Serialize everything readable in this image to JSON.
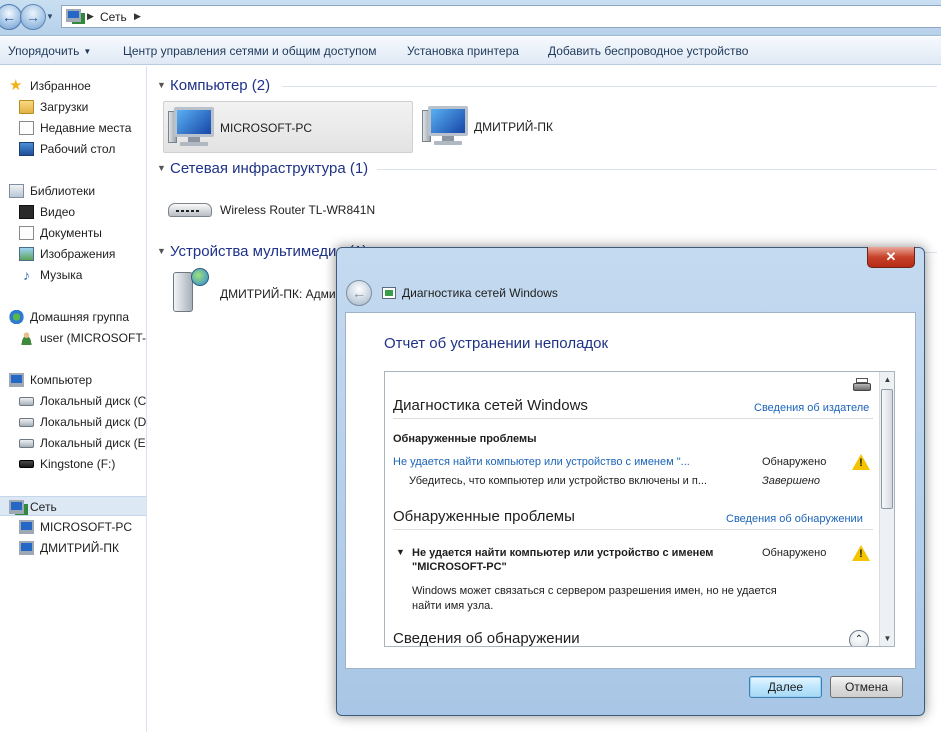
{
  "address_bar": {
    "crumb": "Сеть"
  },
  "toolbar": {
    "organize": "Упорядочить",
    "network_center": "Центр управления сетями и общим доступом",
    "add_printer": "Установка принтера",
    "add_wireless": "Добавить беспроводное устройство"
  },
  "nav": {
    "favorites": {
      "label": "Избранное",
      "icon": "star-icon",
      "items": [
        {
          "label": "Загрузки",
          "icon": "downloads-folder-icon"
        },
        {
          "label": "Недавние места",
          "icon": "recent-places-icon"
        },
        {
          "label": "Рабочий стол",
          "icon": "desktop-icon"
        }
      ]
    },
    "libraries": {
      "label": "Библиотеки",
      "icon": "libraries-icon",
      "items": [
        {
          "label": "Видео",
          "icon": "video-icon"
        },
        {
          "label": "Документы",
          "icon": "documents-icon"
        },
        {
          "label": "Изображения",
          "icon": "pictures-icon"
        },
        {
          "label": "Музыка",
          "icon": "music-icon"
        }
      ]
    },
    "homegroup": {
      "label": "Домашняя группа",
      "icon": "homegroup-icon",
      "items": [
        {
          "label": "user (MICROSOFT-PC)",
          "icon": "user-icon"
        }
      ]
    },
    "computer": {
      "label": "Компьютер",
      "icon": "computer-icon",
      "items": [
        {
          "label": "Локальный диск (C:)",
          "icon": "local-disk-icon"
        },
        {
          "label": "Локальный диск (D:)",
          "icon": "local-disk-icon"
        },
        {
          "label": "Локальный диск (E:)",
          "icon": "local-disk-icon"
        },
        {
          "label": "Kingstone (F:)",
          "icon": "usb-drive-icon"
        }
      ]
    },
    "network": {
      "label": "Сеть",
      "icon": "network-icon",
      "items": [
        {
          "label": "MICROSOFT-PC",
          "icon": "computer-icon"
        },
        {
          "label": "ДМИТРИЙ-ПК",
          "icon": "computer-icon"
        }
      ]
    }
  },
  "content": {
    "groups": [
      {
        "title": "Компьютер (2)",
        "items": [
          {
            "label": "MICROSOFT-PC",
            "icon": "computer-icon",
            "selected": true
          },
          {
            "label": "ДМИТРИЙ-ПК",
            "icon": "computer-icon"
          }
        ]
      },
      {
        "title": "Сетевая инфраструктура (1)",
        "items": [
          {
            "label": "Wireless Router TL-WR841N",
            "icon": "router-icon"
          }
        ]
      },
      {
        "title": "Устройства мультимедиа (1)",
        "items": [
          {
            "label": "ДМИТРИЙ-ПК: Администратор",
            "icon": "media-device-icon"
          }
        ]
      }
    ]
  },
  "dialog": {
    "title": "Диагностика сетей Windows",
    "heading": "Отчет об устранении неполадок",
    "report": {
      "section1_title": "Диагностика сетей Windows",
      "publisher_link": "Сведения об издателе",
      "found_label": "Обнаруженные проблемы",
      "problem_link": "Не удается найти компьютер или устройство с именем \"...",
      "problem_status": "Обнаружено",
      "fix_text": "Убедитесь, что компьютер или устройство включены и п...",
      "fix_status": "Завершено",
      "section2_title": "Обнаруженные проблемы",
      "detection_link": "Сведения об обнаружении",
      "detail_title_line1": "Не удается найти компьютер или устройство с именем",
      "detail_title_line2": "\"MICROSOFT-PC\"",
      "detail_status": "Обнаружено",
      "detail_desc_line1": "Windows может связаться с сервером разрешения имен, но не удается",
      "detail_desc_line2": "найти имя узла.",
      "section3_title": "Сведения об обнаружении"
    },
    "next_button": "Далее",
    "cancel_button": "Отмена"
  },
  "colors": {
    "link": "#1c64b8",
    "group_title": "#1e3287",
    "warning": "#f3c400",
    "close_button": "#c8432b"
  }
}
